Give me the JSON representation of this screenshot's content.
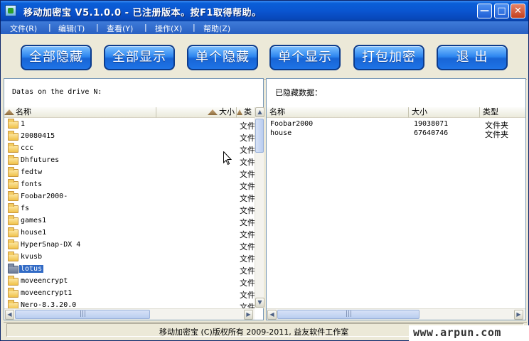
{
  "window": {
    "title": "移动加密宝 V5.1.0.0 - 已注册版本。按F1取得帮助。",
    "min_glyph": "—",
    "max_glyph": "□",
    "close_glyph": "✕"
  },
  "menu": [
    {
      "label": "文件(R)"
    },
    {
      "label": "编辑(T)"
    },
    {
      "label": "查看(Y)"
    },
    {
      "label": "操作(X)"
    },
    {
      "label": "帮助(Z)"
    }
  ],
  "menu_separator": "|",
  "toolbar": {
    "hide_all": "全部隐藏",
    "show_all": "全部显示",
    "hide_one": "单个隐藏",
    "show_one": "单个显示",
    "pack_encrypt": "打包加密",
    "exit": "退  出"
  },
  "left_panel": {
    "header": "Datas on the drive N:",
    "columns": {
      "name": "名称",
      "size": "大小",
      "type": "类"
    },
    "items": [
      {
        "name": "1",
        "type": "文件"
      },
      {
        "name": "20080415",
        "type": "文件"
      },
      {
        "name": "ccc",
        "type": "文件"
      },
      {
        "name": "Dhfutures",
        "type": "文件"
      },
      {
        "name": "fedtw",
        "type": "文件"
      },
      {
        "name": "fonts",
        "type": "文件"
      },
      {
        "name": "Foobar2000-",
        "type": "文件"
      },
      {
        "name": "fs",
        "type": "文件"
      },
      {
        "name": "games1",
        "type": "文件"
      },
      {
        "name": "house1",
        "type": "文件"
      },
      {
        "name": "HyperSnap-DX 4",
        "type": "文件"
      },
      {
        "name": "kvusb",
        "type": "文件"
      },
      {
        "name": "lotus",
        "type": "文件",
        "selected": true
      },
      {
        "name": "moveencrypt",
        "type": "文件"
      },
      {
        "name": "moveencrypt1",
        "type": "文件"
      },
      {
        "name": "Nero-8.3.20.0",
        "type": "文件"
      }
    ]
  },
  "right_panel": {
    "header": "已隐藏数据：",
    "columns": {
      "name": "名称",
      "size": "大小",
      "type": "类型"
    },
    "items": [
      {
        "name": "Foobar2000",
        "size": "19038071",
        "type": "文件夹"
      },
      {
        "name": "house",
        "size": "67640746",
        "type": "文件夹"
      }
    ]
  },
  "scroll_glyphs": {
    "up": "▲",
    "down": "▼",
    "left": "◀",
    "right": "▶",
    "grip": "|||"
  },
  "status": {
    "text": "移动加密宝   (C)版权所有   2009-2011,   益友软件工作室"
  },
  "watermark": "www.arpun.com",
  "colors": {
    "selection": "#316ac5",
    "title_bar": "#0a55d0",
    "button_blue": "#1e73e6"
  },
  "icons": {
    "folder": "folder-icon",
    "app": "app-icon",
    "cursor": "mouse-pointer-icon"
  }
}
